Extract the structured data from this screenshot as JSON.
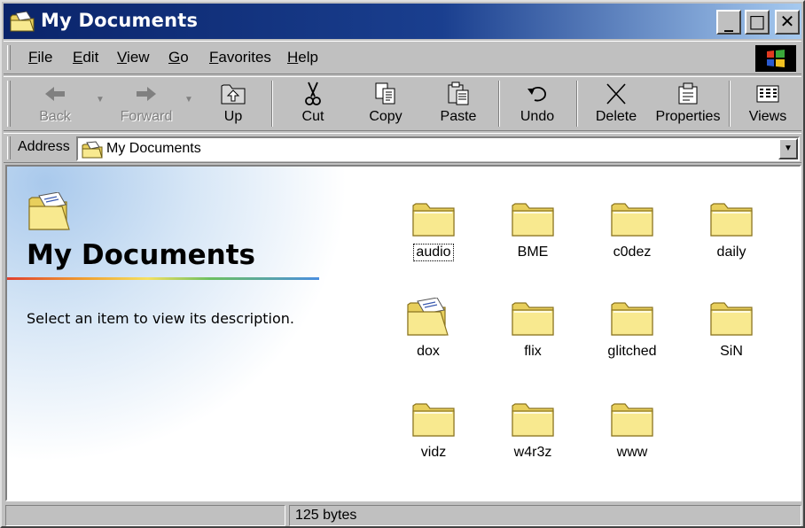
{
  "window": {
    "title": "My Documents",
    "buttons": {
      "minimize": "_",
      "maximize": "□",
      "close": "✕"
    }
  },
  "menu": [
    "File",
    "Edit",
    "View",
    "Go",
    "Favorites",
    "Help"
  ],
  "toolbar": {
    "back": "Back",
    "forward": "Forward",
    "up": "Up",
    "cut": "Cut",
    "copy": "Copy",
    "paste": "Paste",
    "undo": "Undo",
    "delete": "Delete",
    "properties": "Properties",
    "views": "Views"
  },
  "address": {
    "label": "Address",
    "value": "My Documents"
  },
  "webview": {
    "title": "My Documents",
    "description": "Select an item to view its description."
  },
  "folders": [
    {
      "name": "audio",
      "icon": "folder-icon",
      "focused": true
    },
    {
      "name": "BME",
      "icon": "folder-icon"
    },
    {
      "name": "c0dez",
      "icon": "folder-icon"
    },
    {
      "name": "daily",
      "icon": "folder-icon"
    },
    {
      "name": "dox",
      "icon": "open-folder-icon"
    },
    {
      "name": "flix",
      "icon": "folder-icon"
    },
    {
      "name": "glitched",
      "icon": "folder-icon"
    },
    {
      "name": "SiN",
      "icon": "folder-icon"
    },
    {
      "name": "vidz",
      "icon": "folder-icon"
    },
    {
      "name": "w4r3z",
      "icon": "folder-icon"
    },
    {
      "name": "www",
      "icon": "folder-icon"
    }
  ],
  "status": {
    "left": "",
    "size": "125 bytes"
  },
  "colors": {
    "titlebar_start": "#0a246a",
    "titlebar_end": "#a6caf0",
    "face": "#c0c0c0",
    "folder": "#f5e38a"
  }
}
